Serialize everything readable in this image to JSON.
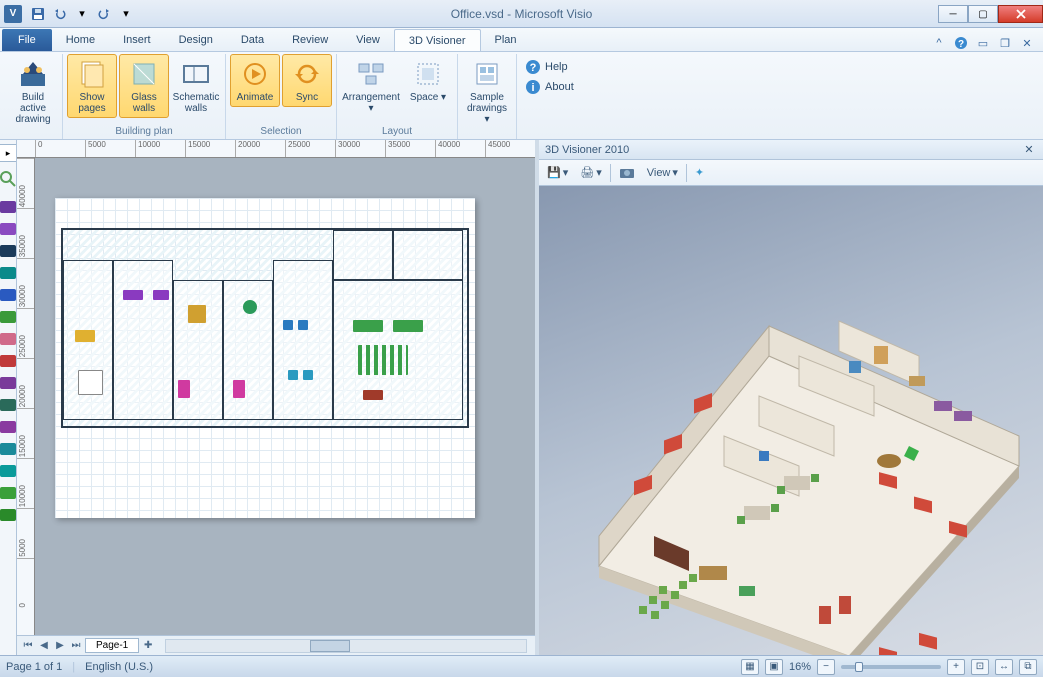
{
  "window": {
    "app_badge": "V",
    "title": "Office.vsd - Microsoft Visio"
  },
  "qat": {
    "save": "save-icon",
    "undo": "undo-icon",
    "redo": "redo-icon"
  },
  "menu": {
    "file": "File",
    "tabs": [
      "Home",
      "Insert",
      "Design",
      "Data",
      "Review",
      "View",
      "3D Visioner",
      "Plan"
    ],
    "active_index": 6
  },
  "ribbon": {
    "groups": [
      {
        "label": "",
        "buttons": [
          {
            "id": "build-active-drawing",
            "label": "Build active\ndrawing",
            "active": false
          }
        ]
      },
      {
        "label": "Building plan",
        "buttons": [
          {
            "id": "show-pages",
            "label": "Show\npages",
            "active": true
          },
          {
            "id": "glass-walls",
            "label": "Glass\nwalls",
            "active": true
          },
          {
            "id": "schematic-walls",
            "label": "Schematic\nwalls",
            "active": false
          }
        ]
      },
      {
        "label": "Selection",
        "buttons": [
          {
            "id": "animate",
            "label": "Animate",
            "active": true
          },
          {
            "id": "sync",
            "label": "Sync",
            "active": true
          }
        ]
      },
      {
        "label": "Layout",
        "buttons": [
          {
            "id": "arrangement",
            "label": "Arrangement\n▾",
            "active": false
          },
          {
            "id": "space",
            "label": "Space\n▾",
            "active": false
          }
        ]
      },
      {
        "label": "",
        "buttons": [
          {
            "id": "sample-drawings",
            "label": "Sample\ndrawings ▾",
            "active": false
          }
        ]
      }
    ],
    "help_col": {
      "help": "Help",
      "about": "About"
    }
  },
  "ruler_h": [
    "0",
    "5000",
    "10000",
    "15000",
    "20000",
    "25000",
    "30000",
    "35000",
    "40000",
    "45000"
  ],
  "ruler_v": [
    "40000",
    "35000",
    "30000",
    "25000",
    "20000",
    "15000",
    "10000",
    "5000",
    "0"
  ],
  "stencil": {
    "header": "▸",
    "shapes": [
      {
        "name": "desk-purple",
        "color": "#6a3aa0"
      },
      {
        "name": "chair-small-purple",
        "color": "#8a4ac0"
      },
      {
        "name": "table-dark",
        "color": "#1a3a5a"
      },
      {
        "name": "table-teal",
        "color": "#0a8a8a"
      },
      {
        "name": "cabinet-blue",
        "color": "#2a5ac0"
      },
      {
        "name": "cabinet-green",
        "color": "#3a9a3a"
      },
      {
        "name": "sofa-pink",
        "color": "#d06a8a"
      },
      {
        "name": "box-red",
        "color": "#c03a3a"
      },
      {
        "name": "rect-purple",
        "color": "#7a3a9a"
      },
      {
        "name": "round-table",
        "color": "#2a6a5a"
      },
      {
        "name": "round-purple",
        "color": "#8a3aa0"
      },
      {
        "name": "square-teal",
        "color": "#1a8a9a"
      },
      {
        "name": "circle-teal",
        "color": "#0a9a9a"
      },
      {
        "name": "plant-green",
        "color": "#3aa03a"
      },
      {
        "name": "bush-green",
        "color": "#2a8a2a"
      }
    ]
  },
  "page_tabs": {
    "current": "Page-1"
  },
  "panel3d": {
    "title": "3D Visioner 2010",
    "toolbar": {
      "save": "💾",
      "print": "🖨",
      "view": "View",
      "expand": "⛶"
    }
  },
  "statusbar": {
    "page_info": "Page 1 of 1",
    "language": "English (U.S.)",
    "zoom": "16%"
  }
}
